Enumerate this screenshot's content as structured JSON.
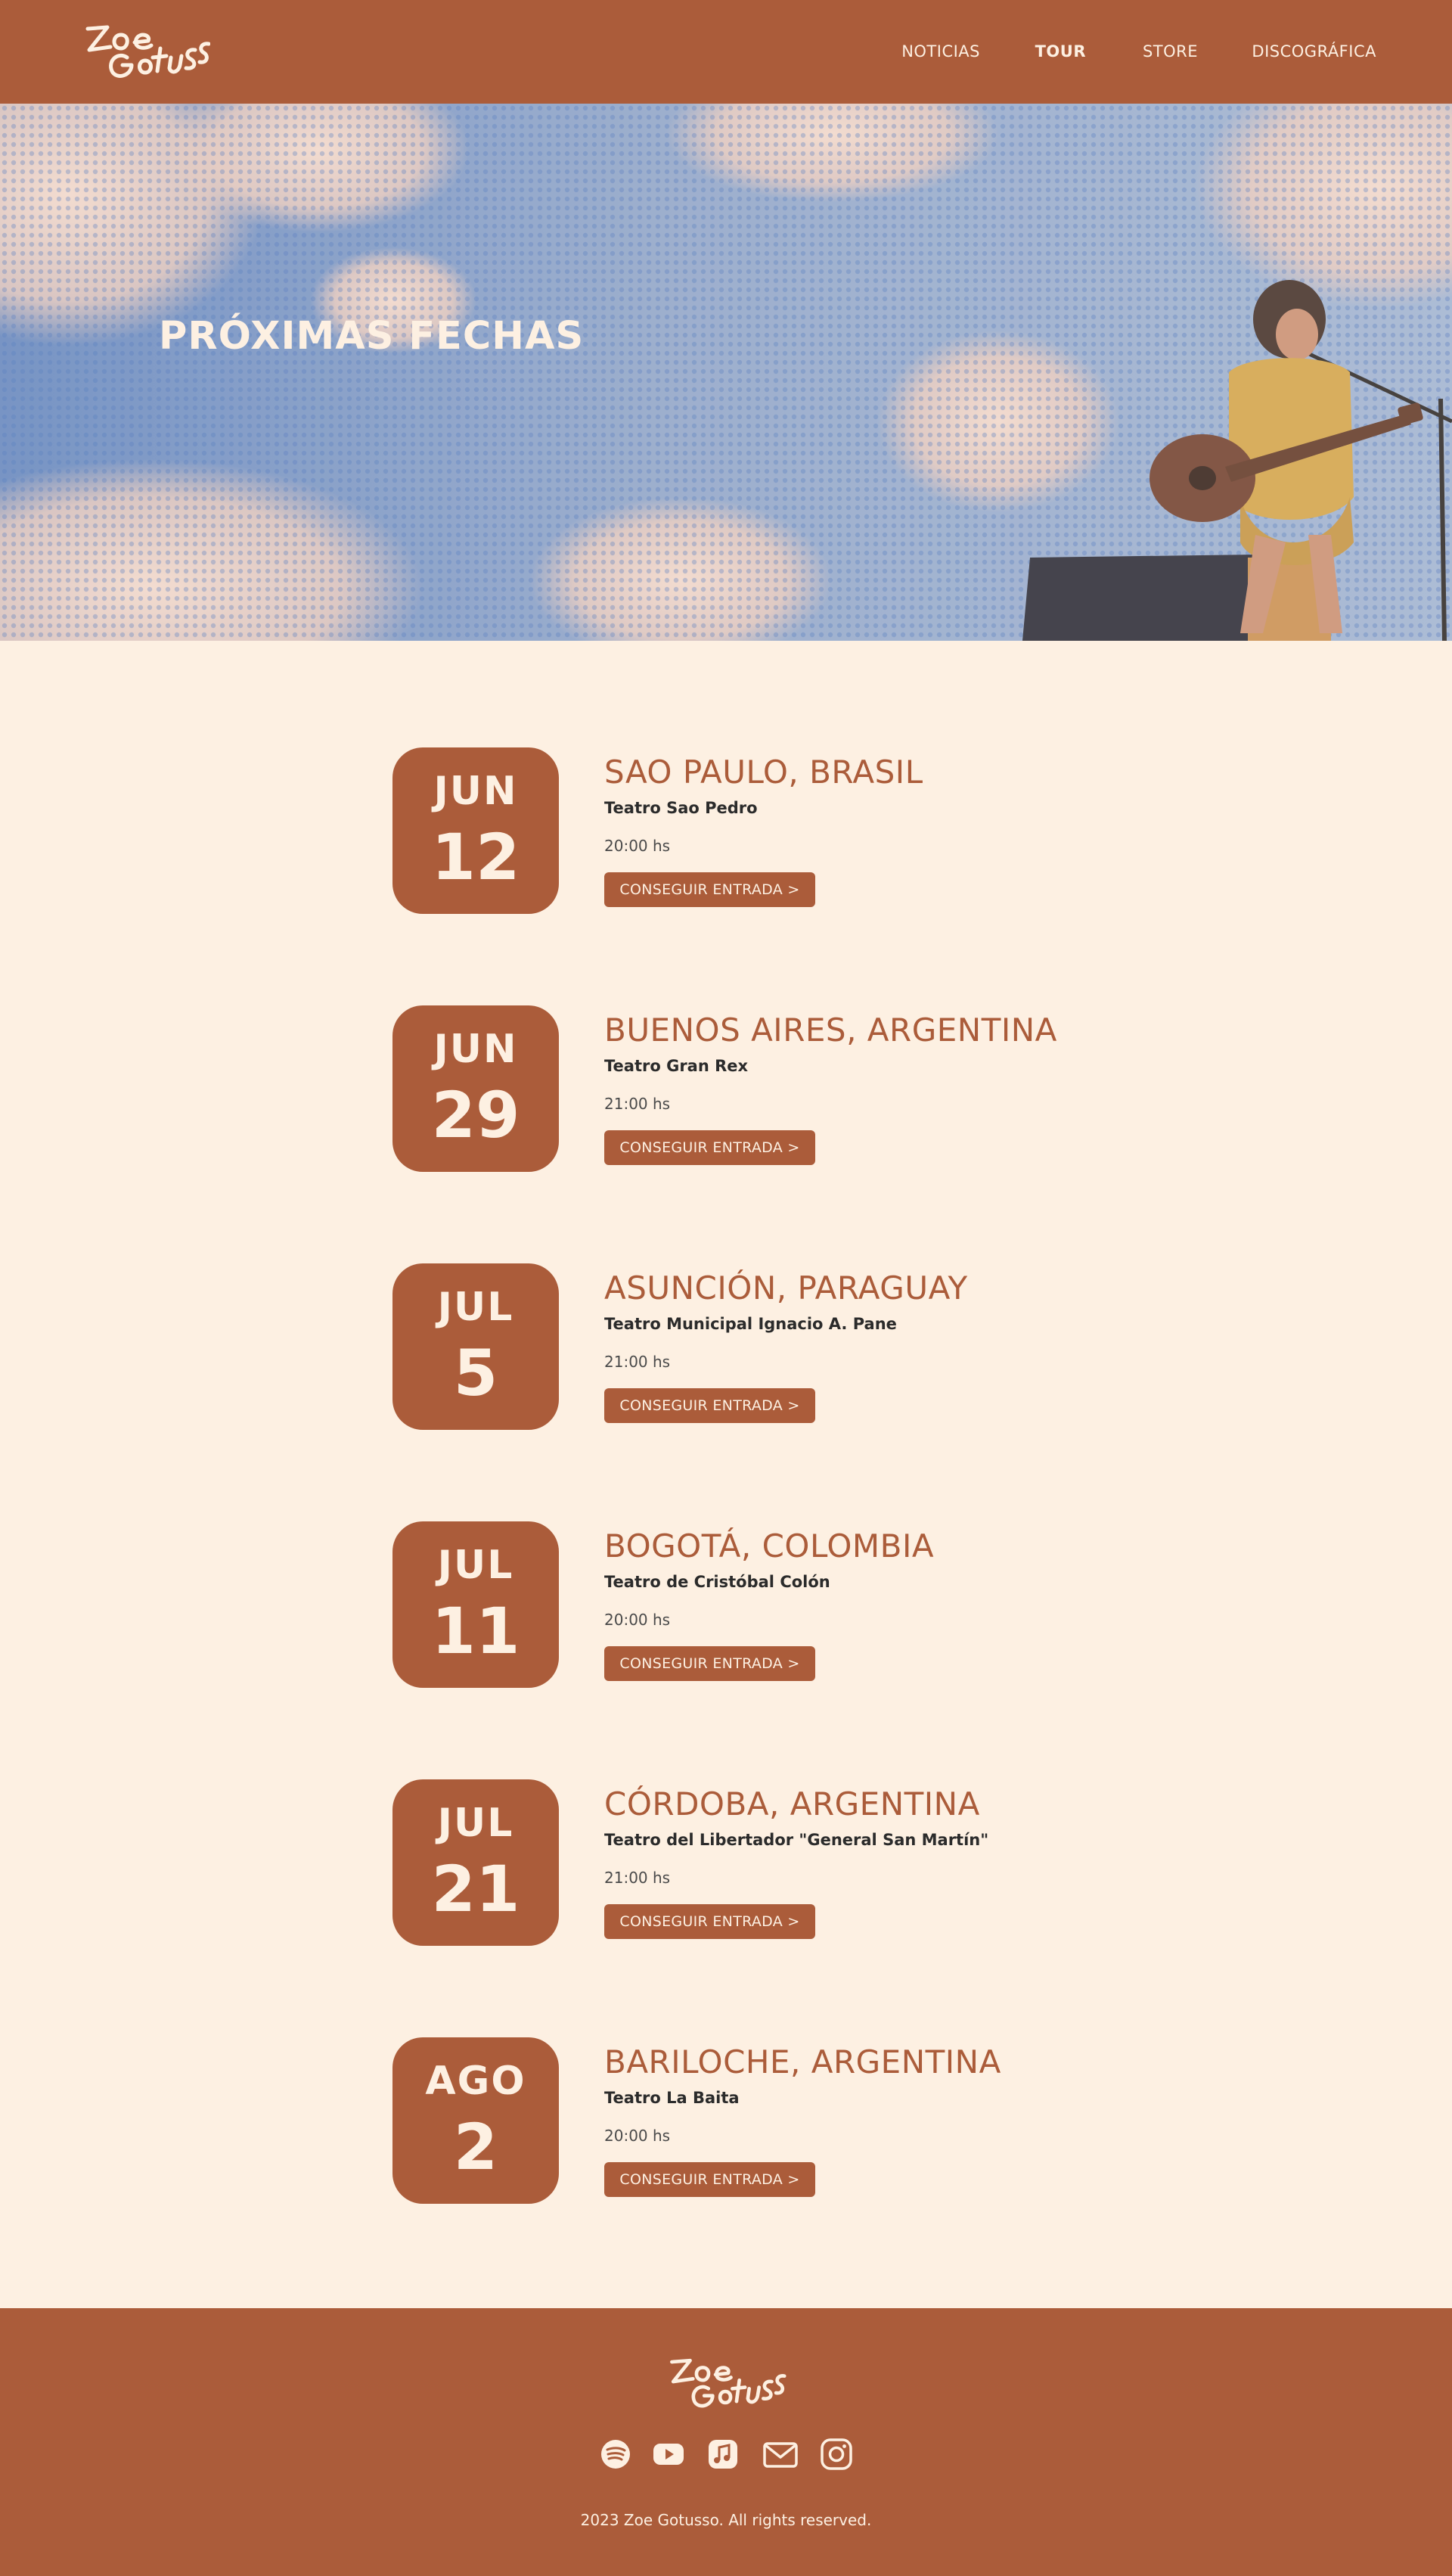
{
  "header": {
    "logo_text": "Zoe Gotusso",
    "nav": [
      {
        "label": "NOTICIAS",
        "active": false
      },
      {
        "label": "TOUR",
        "active": true
      },
      {
        "label": "STORE",
        "active": false
      },
      {
        "label": "DISCOGRÁFICA",
        "active": false
      }
    ]
  },
  "hero": {
    "title": "PRÓXIMAS FECHAS"
  },
  "events": [
    {
      "month": "JUN",
      "day": "12",
      "city": "SAO PAULO, BRASIL",
      "venue": "Teatro Sao Pedro",
      "time": "20:00 hs",
      "button": "CONSEGUIR ENTRADA >"
    },
    {
      "month": "JUN",
      "day": "29",
      "city": "BUENOS AIRES, ARGENTINA",
      "venue": "Teatro Gran Rex",
      "time": "21:00 hs",
      "button": "CONSEGUIR ENTRADA >"
    },
    {
      "month": "JUL",
      "day": "5",
      "city": "ASUNCIÓN, PARAGUAY",
      "venue": "Teatro Municipal Ignacio A. Pane",
      "time": "21:00 hs",
      "button": "CONSEGUIR ENTRADA >"
    },
    {
      "month": "JUL",
      "day": "11",
      "city": "BOGOTÁ, COLOMBIA",
      "venue": "Teatro de Cristóbal Colón",
      "time": "20:00 hs",
      "button": "CONSEGUIR ENTRADA >"
    },
    {
      "month": "JUL",
      "day": "21",
      "city": "CÓRDOBA, ARGENTINA",
      "venue": "Teatro del Libertador \"General San Martín\"",
      "time": "21:00 hs",
      "button": "CONSEGUIR ENTRADA >"
    },
    {
      "month": "AGO",
      "day": "2",
      "city": "BARILOCHE, ARGENTINA",
      "venue": "Teatro La Baita",
      "time": "20:00 hs",
      "button": "CONSEGUIR ENTRADA >"
    }
  ],
  "footer": {
    "logo_text": "Zoe Gotusso",
    "social": [
      "spotify-icon",
      "youtube-icon",
      "apple-music-icon",
      "mail-icon",
      "instagram-icon"
    ],
    "copyright": "2023 Zoe Gotusso. All rights reserved."
  },
  "colors": {
    "brand": "#ab5c3a",
    "background": "#fdf0e2",
    "text": "#2b2b2b"
  }
}
